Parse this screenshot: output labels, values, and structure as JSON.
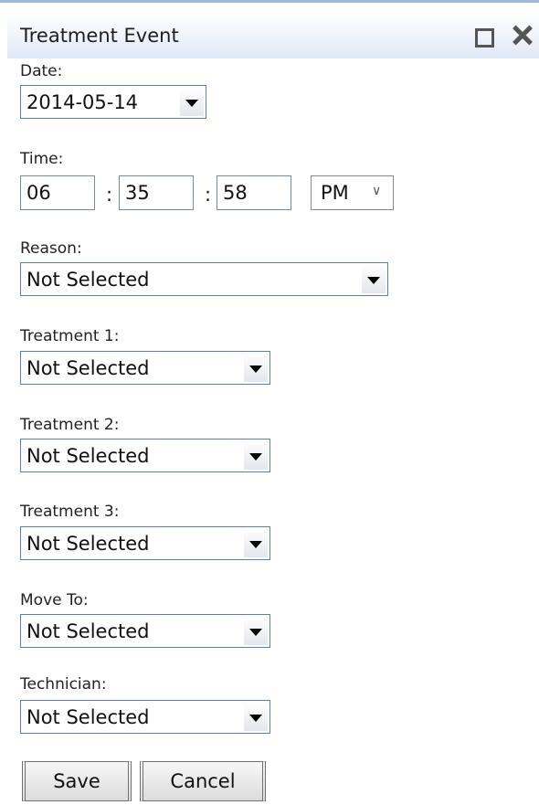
{
  "window": {
    "title": "Treatment Event",
    "maximize_icon": "maximize-icon",
    "close_icon": "close-icon"
  },
  "date": {
    "label": "Date:",
    "value": "2014-05-14"
  },
  "time": {
    "label": "Time:",
    "hour": "06",
    "minute": "35",
    "second": "58",
    "separator": ":",
    "ampm": "PM",
    "ampm_chevron": "∨"
  },
  "reason": {
    "label": "Reason:",
    "value": "Not Selected"
  },
  "treatment1": {
    "label": "Treatment 1:",
    "value": "Not Selected"
  },
  "treatment2": {
    "label": "Treatment 2:",
    "value": "Not Selected"
  },
  "treatment3": {
    "label": "Treatment 3:",
    "value": "Not Selected"
  },
  "move_to": {
    "label": "Move To:",
    "value": "Not Selected"
  },
  "technician": {
    "label": "Technician:",
    "value": "Not Selected"
  },
  "buttons": {
    "save": "Save",
    "cancel": "Cancel"
  },
  "colors": {
    "title_bg": "#dfe8f6",
    "select_border": "#5b7cbf",
    "top_line": "#9fb6d8"
  }
}
